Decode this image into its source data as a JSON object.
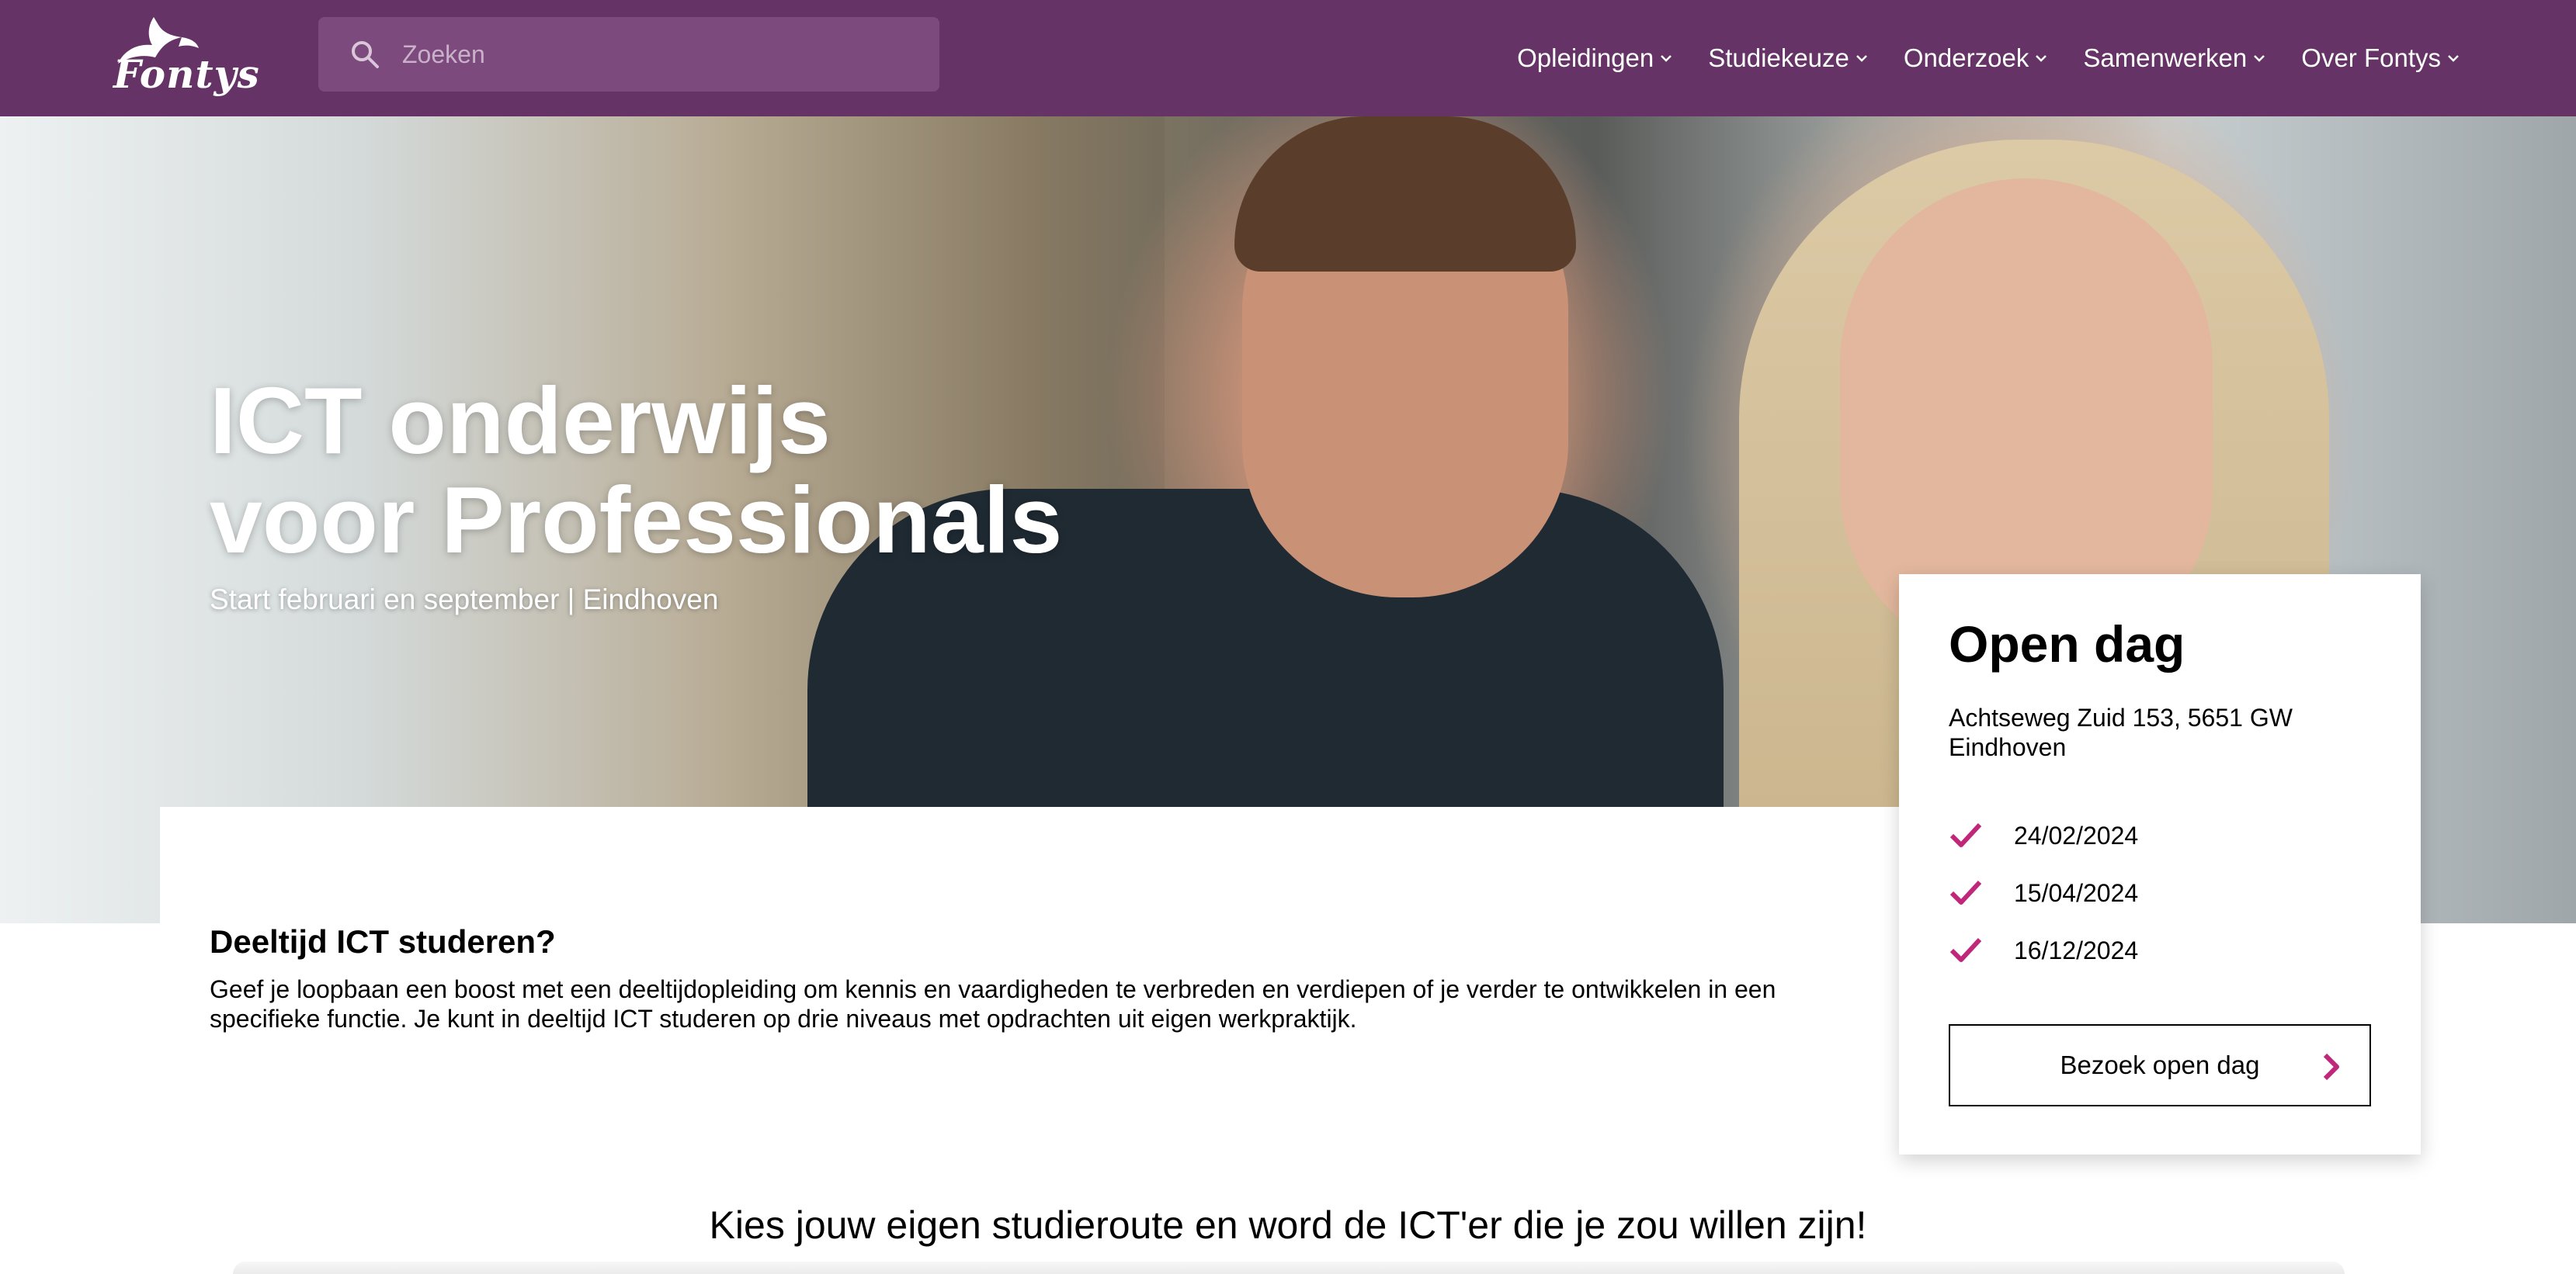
{
  "header": {
    "logo_text": "Fontys",
    "search": {
      "placeholder": "Zoeken",
      "value": ""
    },
    "nav": [
      {
        "label": "Opleidingen"
      },
      {
        "label": "Studiekeuze"
      },
      {
        "label": "Onderzoek"
      },
      {
        "label": "Samenwerken"
      },
      {
        "label": "Over Fontys"
      }
    ]
  },
  "hero": {
    "title_line1": "ICT onderwijs",
    "title_line2": "voor Professionals",
    "subtitle": "Start februari en september | Eindhoven"
  },
  "intro": {
    "title": "Deeltijd ICT studeren?",
    "text": "Geef je loopbaan een boost met een deeltijdopleiding om kennis en vaardigheden te verbreden en verdiepen of je verder te ontwikkelen in een specifieke functie. Je kunt in deeltijd ICT studeren op drie niveaus met opdrachten uit eigen werkpraktijk."
  },
  "open_dag": {
    "title": "Open dag",
    "address": "Achtseweg Zuid 153, 5651 GW Eindhoven",
    "dates": [
      "24/02/2024",
      "15/04/2024",
      "16/12/2024"
    ],
    "button_label": "Bezoek open dag"
  },
  "routes": {
    "heading": "Kies jouw eigen studieroute en word de ICT'er die je zou willen zijn!"
  },
  "colors": {
    "brand_purple": "#663366",
    "accent_magenta": "#c0267a"
  },
  "icons": {
    "search": "search-icon",
    "check": "check-icon",
    "chevron": "chevron-down-icon",
    "arrow": "chevron-right-icon"
  }
}
